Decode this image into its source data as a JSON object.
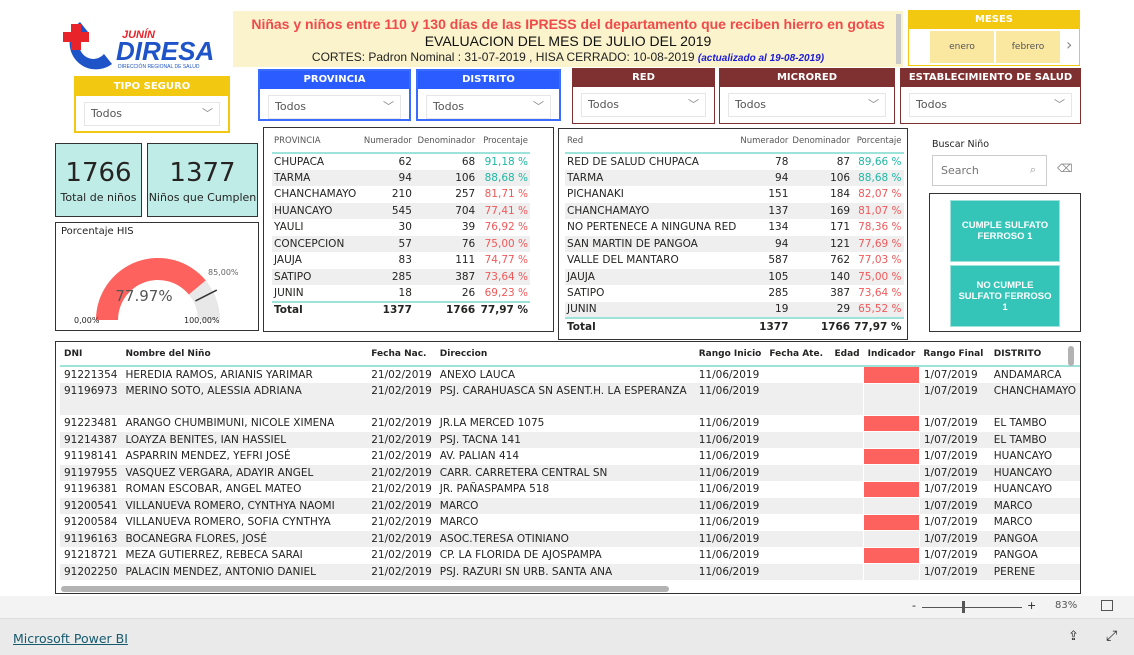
{
  "logo": {
    "text_top": "JUNÍN",
    "text_main": "DIRESA",
    "text_sub": "DIRECCIÓN REGIONAL DE SALUD"
  },
  "header": {
    "title": "Niñas y niños entre 110 y 130 días de las IPRESS del departamento que reciben hierro en gotas",
    "subtitle": "EVALUACION DEL MES DE JULIO DEL 2019",
    "cortes": "CORTES: Padron Nominal : 31-07-2019 ,  HISA CERRADO: 10-08-2019",
    "updated": "(actualizado al  19-08-2019)"
  },
  "meses": {
    "title": "MESES",
    "items": [
      "enero",
      "febrero"
    ]
  },
  "slicers": {
    "tipo_seguro": {
      "label": "TIPO SEGURO",
      "value": "Todos"
    },
    "provincia": {
      "label": "PROVINCIA",
      "value": "Todos"
    },
    "distrito": {
      "label": "DISTRITO",
      "value": "Todos"
    },
    "red": {
      "label": "RED",
      "value": "Todos"
    },
    "microred": {
      "label": "MICRORED",
      "value": "Todos"
    },
    "establecimiento": {
      "label": "ESTABLECIMIENTO DE SALUD",
      "value": "Todos"
    }
  },
  "kpis": {
    "total": {
      "value": "1766",
      "label": "Total de niños"
    },
    "cumplen": {
      "value": "1377",
      "label": "Niños que Cumplen"
    }
  },
  "gauge": {
    "title": "Porcentaje HIS",
    "value": 77.97,
    "value_label": "77.97%",
    "target": 85,
    "target_label": "85,00%",
    "min_label": "0,00%",
    "max_label": "100,00%",
    "fill_color": "#fd625e",
    "track_color": "#e8e8e8"
  },
  "provincia_table": {
    "headers": [
      "PROVINCIA",
      "Numerador",
      "Denominador",
      "Procentaje"
    ],
    "rows": [
      [
        "CHUPACA",
        "62",
        "68",
        "91,18 %"
      ],
      [
        "TARMA",
        "94",
        "106",
        "88,68 %"
      ],
      [
        "CHANCHAMAYO",
        "210",
        "257",
        "81,71 %"
      ],
      [
        "HUANCAYO",
        "545",
        "704",
        "77,41 %"
      ],
      [
        "YAULI",
        "30",
        "39",
        "76,92 %"
      ],
      [
        "CONCEPCION",
        "57",
        "76",
        "75,00 %"
      ],
      [
        "JAUJA",
        "83",
        "111",
        "74,77 %"
      ],
      [
        "SATIPO",
        "285",
        "387",
        "73,64 %"
      ],
      [
        "JUNIN",
        "18",
        "26",
        "69,23 %"
      ]
    ],
    "total": [
      "Total",
      "1377",
      "1766",
      "77,97 %"
    ]
  },
  "red_table": {
    "headers": [
      "Red",
      "Numerador",
      "Denominador",
      "Porcentaje"
    ],
    "rows": [
      [
        "RED DE SALUD CHUPACA",
        "78",
        "87",
        "89,66 %"
      ],
      [
        "TARMA",
        "94",
        "106",
        "88,68 %"
      ],
      [
        "PICHANAKI",
        "151",
        "184",
        "82,07 %"
      ],
      [
        "CHANCHAMAYO",
        "137",
        "169",
        "81,07 %"
      ],
      [
        "NO PERTENECE A NINGUNA RED",
        "134",
        "171",
        "78,36 %"
      ],
      [
        "SAN MARTIN DE PANGOA",
        "94",
        "121",
        "77,69 %"
      ],
      [
        "VALLE DEL MANTARO",
        "587",
        "762",
        "77,03 %"
      ],
      [
        "JAUJA",
        "105",
        "140",
        "75,00 %"
      ],
      [
        "SATIPO",
        "285",
        "387",
        "73,64 %"
      ],
      [
        "JUNIN",
        "19",
        "29",
        "65,52 %"
      ]
    ],
    "total": [
      "Total",
      "1377",
      "1766",
      "77,97 %"
    ]
  },
  "search": {
    "label": "Buscar Niño",
    "placeholder": "Search"
  },
  "buttons": {
    "cumple": "CUMPLE SULFATO FERROSO 1",
    "no_cumple": "NO CUMPLE SULFATO FERROSO 1"
  },
  "detail_table": {
    "headers": [
      "DNI",
      "Nombre del Niño",
      "Fecha Nac.",
      "Direccion",
      "Rango Inicio",
      "Fecha Ate.",
      "Edad",
      "Indicador",
      "Rango Final",
      "DISTRITO"
    ],
    "indicator_color": "#fd625e",
    "rows": [
      [
        "91221354",
        "HEREDIA RAMOS, ARIANIS YARIMAR",
        "21/02/2019",
        "ANEXO LAUCA",
        "11/06/2019",
        "",
        "",
        "",
        "1/07/2019",
        "ANDAMARCA"
      ],
      [
        "91196973",
        "MERINO SOTO, ALESSIA ADRIANA",
        "21/02/2019",
        "PSJ. CARAHUASCA SN ASENT.H. LA ESPERANZA",
        "11/06/2019",
        "",
        "",
        "",
        "1/07/2019",
        "CHANCHAMAYO"
      ],
      [
        "91223481",
        "ARANGO CHUMBIMUNI, NICOLE XIMENA",
        "21/02/2019",
        "JR.LA MERCED 1075",
        "11/06/2019",
        "",
        "",
        "",
        "1/07/2019",
        "EL TAMBO"
      ],
      [
        "91214387",
        "LOAYZA BENITES, IAN HASSIEL",
        "21/02/2019",
        "PSJ. TACNA 141",
        "11/06/2019",
        "",
        "",
        "",
        "1/07/2019",
        "EL TAMBO"
      ],
      [
        "91198141",
        "ASPARRIN MENDEZ, YEFRI JOSÉ",
        "21/02/2019",
        "AV. PALIAN 414",
        "11/06/2019",
        "",
        "",
        "",
        "1/07/2019",
        "HUANCAYO"
      ],
      [
        "91197955",
        "VASQUEZ VERGARA, ADAYIR ANGEL",
        "21/02/2019",
        "CARR. CARRETERA CENTRAL SN",
        "11/06/2019",
        "",
        "",
        "",
        "1/07/2019",
        "HUANCAYO"
      ],
      [
        "91196381",
        "ROMAN ESCOBAR, ANGEL MATEO",
        "21/02/2019",
        "JR. PAÑASPAMPA 518",
        "11/06/2019",
        "",
        "",
        "",
        "1/07/2019",
        "HUANCAYO"
      ],
      [
        "91200541",
        "VILLANUEVA ROMERO, CYNTHYA NAOMI",
        "21/02/2019",
        "MARCO",
        "11/06/2019",
        "",
        "",
        "",
        "1/07/2019",
        "MARCO"
      ],
      [
        "91200584",
        "VILLANUEVA ROMERO, SOFIA CYNTHYA",
        "21/02/2019",
        "MARCO",
        "11/06/2019",
        "",
        "",
        "",
        "1/07/2019",
        "MARCO"
      ],
      [
        "91196163",
        "BOCANEGRA FLORES, JOSÉ",
        "21/02/2019",
        "ASOC.TERESA OTINIANO",
        "11/06/2019",
        "",
        "",
        "",
        "1/07/2019",
        "PANGOA"
      ],
      [
        "91218721",
        "MEZA GUTIERREZ, REBECA SARAI",
        "21/02/2019",
        "CP. LA FLORIDA DE AJOSPAMPA",
        "11/06/2019",
        "",
        "",
        "",
        "1/07/2019",
        "PANGOA"
      ],
      [
        "91202250",
        "PALACIN MENDEZ, ANTONIO DANIEL",
        "21/02/2019",
        "PSJ. RAZURI SN URB. SANTA ANA",
        "11/06/2019",
        "",
        "",
        "",
        "1/07/2019",
        "PERENE"
      ]
    ]
  },
  "zoom": {
    "level": "83%",
    "slider_percent": 35
  },
  "footer": {
    "brand_link": "Microsoft Power BI"
  }
}
